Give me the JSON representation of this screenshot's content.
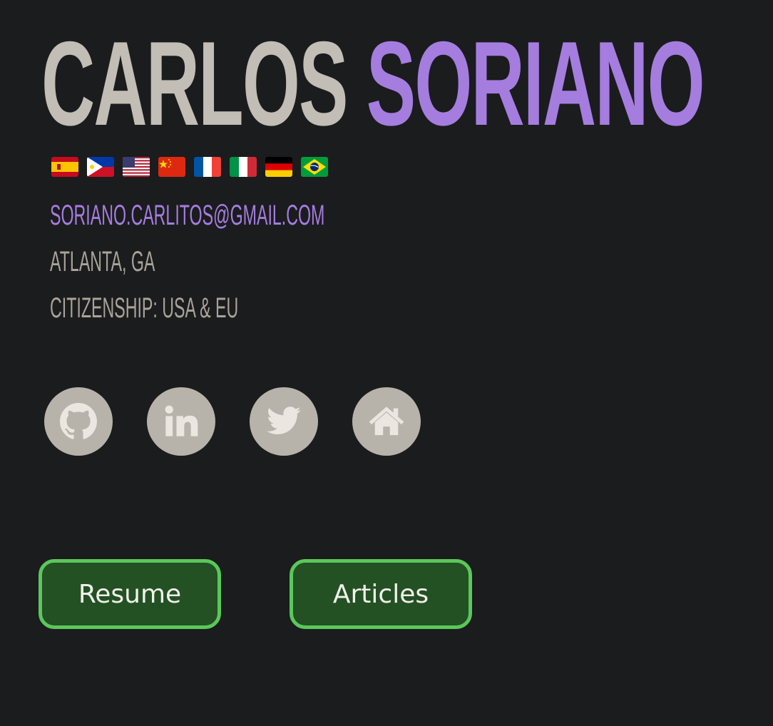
{
  "profile": {
    "first_name": "CARLOS",
    "last_name": "SORIANO",
    "email": "SORIANO.CARLITOS@GMAIL.COM",
    "location": "ATLANTA, GA",
    "citizenship": "CITIZENSHIP: USA & EU"
  },
  "flags": [
    {
      "icon": "spain-flag-icon"
    },
    {
      "icon": "philippines-flag-icon"
    },
    {
      "icon": "usa-flag-icon"
    },
    {
      "icon": "china-flag-icon"
    },
    {
      "icon": "france-flag-icon"
    },
    {
      "icon": "italy-flag-icon"
    },
    {
      "icon": "germany-flag-icon"
    },
    {
      "icon": "brazil-flag-icon"
    }
  ],
  "socials": [
    {
      "icon": "github-icon"
    },
    {
      "icon": "linkedin-icon"
    },
    {
      "icon": "twitter-icon"
    },
    {
      "icon": "home-icon"
    }
  ],
  "buttons": {
    "resume_label": "Resume",
    "articles_label": "Articles"
  },
  "colors": {
    "background": "#1b1c1e",
    "accent_purple": "#a57ddf",
    "text_light": "#c2bdb5",
    "text_muted": "#a9a398",
    "social_circle": "#b8b3aa",
    "button_fill": "#235124",
    "button_border": "#5ac85a"
  }
}
